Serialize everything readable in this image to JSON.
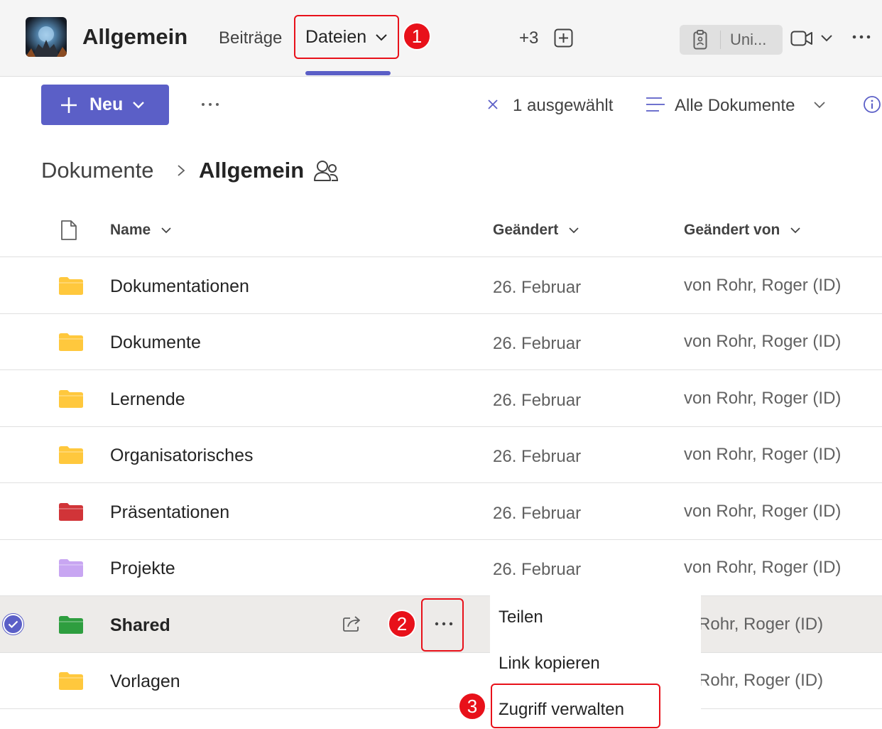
{
  "header": {
    "team_name": "Allgemein",
    "tabs": [
      {
        "label": "Beiträge"
      },
      {
        "label": "Dateien"
      }
    ],
    "more_tabs": "+3",
    "app_label": "Uni..."
  },
  "toolbar": {
    "new_label": "Neu",
    "selection": "1 ausgewählt",
    "view": "Alle Dokumente"
  },
  "breadcrumb": {
    "root": "Dokumente",
    "current": "Allgemein"
  },
  "table": {
    "columns": [
      "Name",
      "Geändert",
      "Geändert von"
    ],
    "rows": [
      {
        "name": "Dokumentationen",
        "modified": "26. Februar",
        "modified_by": "von Rohr, Roger (ID)",
        "folder_color": "#ffc83d"
      },
      {
        "name": "Dokumente",
        "modified": "26. Februar",
        "modified_by": "von Rohr, Roger (ID)",
        "folder_color": "#ffc83d"
      },
      {
        "name": "Lernende",
        "modified": "26. Februar",
        "modified_by": "von Rohr, Roger (ID)",
        "folder_color": "#ffc83d"
      },
      {
        "name": "Organisatorisches",
        "modified": "26. Februar",
        "modified_by": "von Rohr, Roger (ID)",
        "folder_color": "#ffc83d"
      },
      {
        "name": "Präsentationen",
        "modified": "26. Februar",
        "modified_by": "von Rohr, Roger (ID)",
        "folder_color": "#d13438"
      },
      {
        "name": "Projekte",
        "modified": "26. Februar",
        "modified_by": "von Rohr, Roger (ID)",
        "folder_color": "#c8a6f2"
      },
      {
        "name": "Shared",
        "modified": "",
        "modified_by": "n Rohr, Roger (ID)",
        "folder_color": "#2e9e3f"
      },
      {
        "name": "Vorlagen",
        "modified": "",
        "modified_by": "n Rohr, Roger (ID)",
        "folder_color": "#ffc83d"
      }
    ]
  },
  "context_menu": {
    "items": [
      "Teilen",
      "Link kopieren",
      "Zugriff verwalten"
    ]
  },
  "callouts": [
    "1",
    "2",
    "3"
  ],
  "colors": {
    "accent": "#5b5fc7",
    "highlight": "#e8111a"
  }
}
